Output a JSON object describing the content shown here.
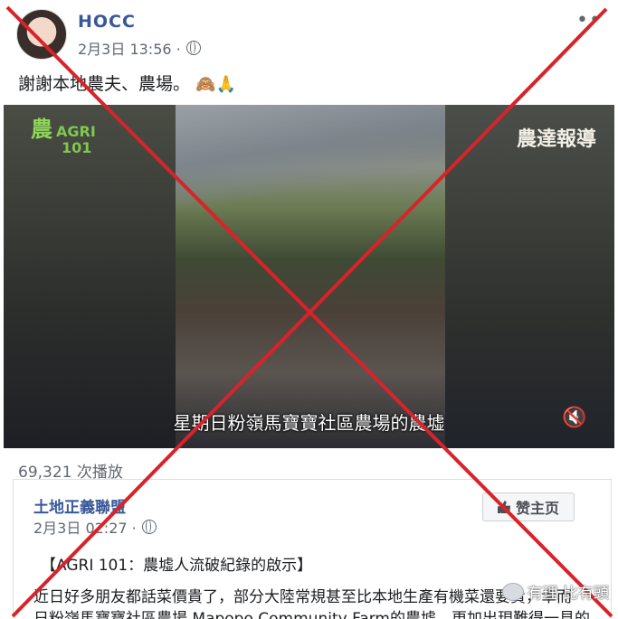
{
  "post": {
    "author": "HOCC",
    "date": "2月3日 13:56 ·",
    "more_icon": "more-dots-icon",
    "caption": "謝謝本地農夫、農場。",
    "caption_emoji": "🙈🙏"
  },
  "video": {
    "logo_left_top": "AGRI",
    "logo_left_bottom": "101",
    "logo_left_mark": "農",
    "logo_right": "農達報導",
    "subtitle": "星期日粉嶺馬寶寶社區農場的農墟",
    "mute_icon": "🔇"
  },
  "views": "69,321 次播放",
  "shared": {
    "page_name": "土地正義聯盟",
    "date": "2月3日 02:27 ·",
    "like_page_label": "赞主页",
    "title": "【AGRI 101：農墟人流破紀錄的啟示】",
    "body_line1": "近日好多朋友都話菜價貴了，部分大陸常規甚至比本地生產有機菜還要貴，幸而",
    "body_line2": "日粉嶺馬寶寶社區農場 Mapopo Community Farm的農墟，更加出現難得一見的"
  },
  "watermark": "有理 比有頭",
  "colors": {
    "link": "#385898",
    "cross": "#d8232a"
  }
}
